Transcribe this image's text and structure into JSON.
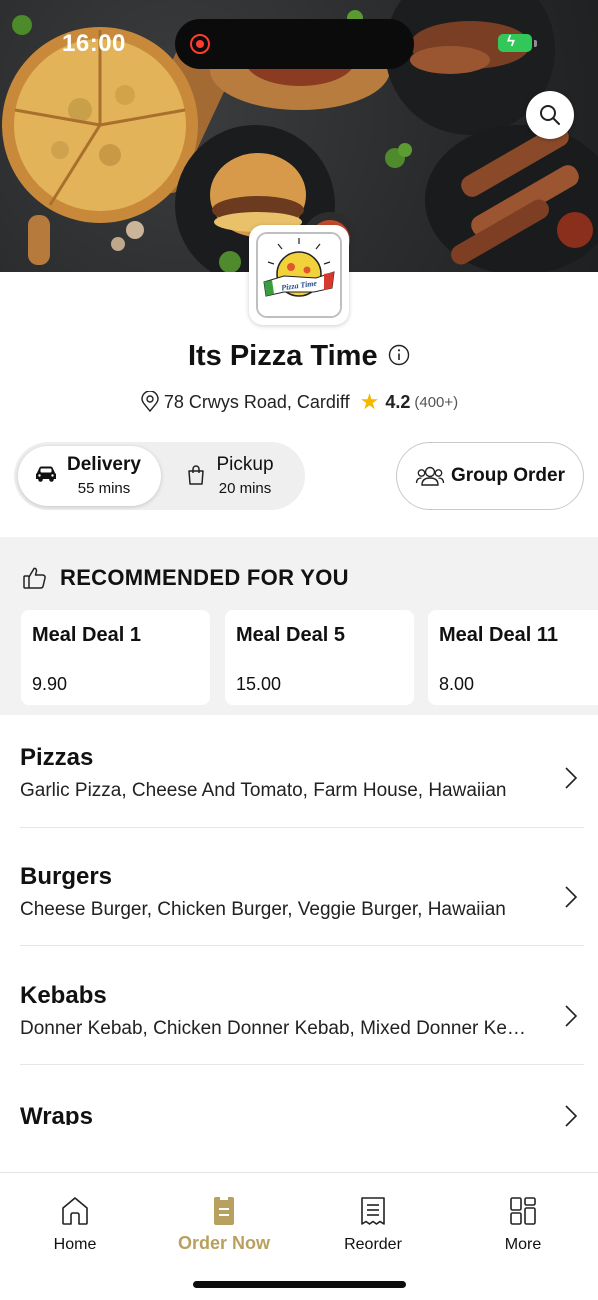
{
  "status_bar": {
    "time": "16:00"
  },
  "restaurant": {
    "name": "Its Pizza Time",
    "address": "78 Crwys Road, Cardiff",
    "rating": "4.2",
    "rating_count": "(400+)",
    "logo_text": "Pizza Time"
  },
  "order_modes": {
    "delivery": {
      "label": "Delivery",
      "time": "55 mins",
      "selected": true
    },
    "pickup": {
      "label": "Pickup",
      "time": "20 mins",
      "selected": false
    }
  },
  "group_order": {
    "label": "Group Order"
  },
  "recommended": {
    "heading": "RECOMMENDED FOR YOU",
    "items": [
      {
        "name": "Meal Deal 1",
        "price": "9.90"
      },
      {
        "name": "Meal Deal 5",
        "price": "15.00"
      },
      {
        "name": "Meal Deal 11",
        "price": "8.00"
      }
    ]
  },
  "categories": [
    {
      "name": "Pizzas",
      "description": "Garlic Pizza, Cheese And Tomato, Farm House, Hawaiian"
    },
    {
      "name": "Burgers",
      "description": "Cheese Burger, Chicken Burger, Veggie Burger, Hawaiian"
    },
    {
      "name": "Kebabs",
      "description": "Donner Kebab, Chicken Donner Kebab, Mixed Donner Kebab"
    },
    {
      "name": "Wraps",
      "description": ""
    }
  ],
  "tabbar": {
    "home": "Home",
    "order_now": "Order Now",
    "reorder": "Reorder",
    "more": "More"
  },
  "colors": {
    "accent": "#b8a15e",
    "star": "#f5b800",
    "battery": "#32c759",
    "recording": "#ff3b30",
    "section_bg": "#f2f2f2"
  }
}
